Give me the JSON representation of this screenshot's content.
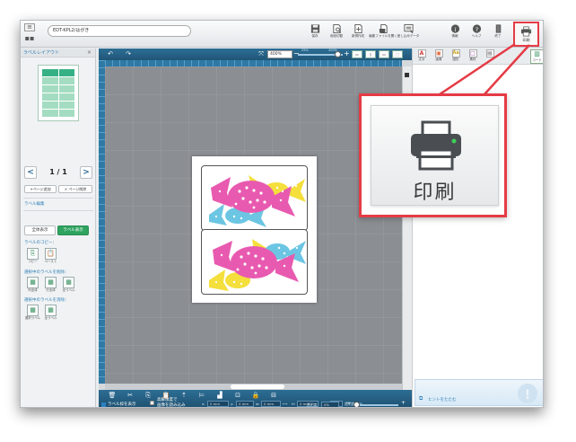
{
  "window": {
    "filename": "EDT-KPL2/はがき"
  },
  "toolbar": {
    "buttons": [
      {
        "label": "保存"
      },
      {
        "label": "用紙切替"
      },
      {
        "label": "新規作成"
      },
      {
        "label": "編集ファイルを開く"
      },
      {
        "label": "差し込みデータ"
      },
      {
        "label": "情報"
      },
      {
        "label": "ヘルプ"
      },
      {
        "label": "終了"
      }
    ],
    "print_label": "印刷"
  },
  "left_panel": {
    "title": "ラベルレイアウト",
    "close": "×",
    "page_indicator": "1 / 1",
    "prev": "<",
    "next": ">",
    "add_page": "+ページ追加",
    "delete_page": "× ページ削除",
    "label_edit_title": "ラベル編集",
    "tab_all": "全体表示",
    "tab_label": "ラベル表示",
    "copy_title": "ラベルのコピー：",
    "copy": "コピー",
    "paste": "ペースト",
    "delete_title": "選択中のラベルを削除：",
    "delete_items": [
      "列全体",
      "行全体",
      "全ラベル"
    ],
    "erase_title": "選択中のラベルを消除：",
    "erase_items": [
      "選択ラベル",
      "全ラベル"
    ]
  },
  "canvas": {
    "zoom_value": "400%",
    "zoom_min_label": "25%",
    "zoom_max_label": "400%"
  },
  "bottom_bar": {
    "x_label": "x:",
    "x_value": "0 mm",
    "y_label": "y:",
    "y_value": "0 mm",
    "w_label": "w:",
    "w_value": "0 mm",
    "h_label": "H:",
    "h_value": "0 mm",
    "rotate_value": "0°",
    "transparency_label": "透明度",
    "transparency2_label": "透明度",
    "transparency_value": "0%",
    "show_frame": "ラベル枠を表示",
    "high_speed_line1": "高解像度で",
    "high_speed_line2": "画像を読み込み"
  },
  "right_panel": {
    "tools": [
      {
        "label": "文字",
        "glyph": "A",
        "color": "#d23b3b"
      },
      {
        "label": "画像",
        "glyph": "▣",
        "color": "#e0663a"
      },
      {
        "label": "図形",
        "glyph": "Aa",
        "color": "#c8a014"
      },
      {
        "label": "素材",
        "glyph": "□",
        "color": "#a0489c"
      },
      {
        "label": "",
        "glyph": "▤",
        "color": "#666666"
      }
    ],
    "code_label": "コード",
    "hint_toggle": "ヒントをたたむ"
  },
  "callout": {
    "label": "印刷"
  },
  "colors": {
    "accent": "#2d6e95",
    "highlight": "#e53b45",
    "candy_pink": "#e85ab0",
    "candy_yellow": "#f4df3c",
    "candy_blue": "#6cc6e3"
  }
}
